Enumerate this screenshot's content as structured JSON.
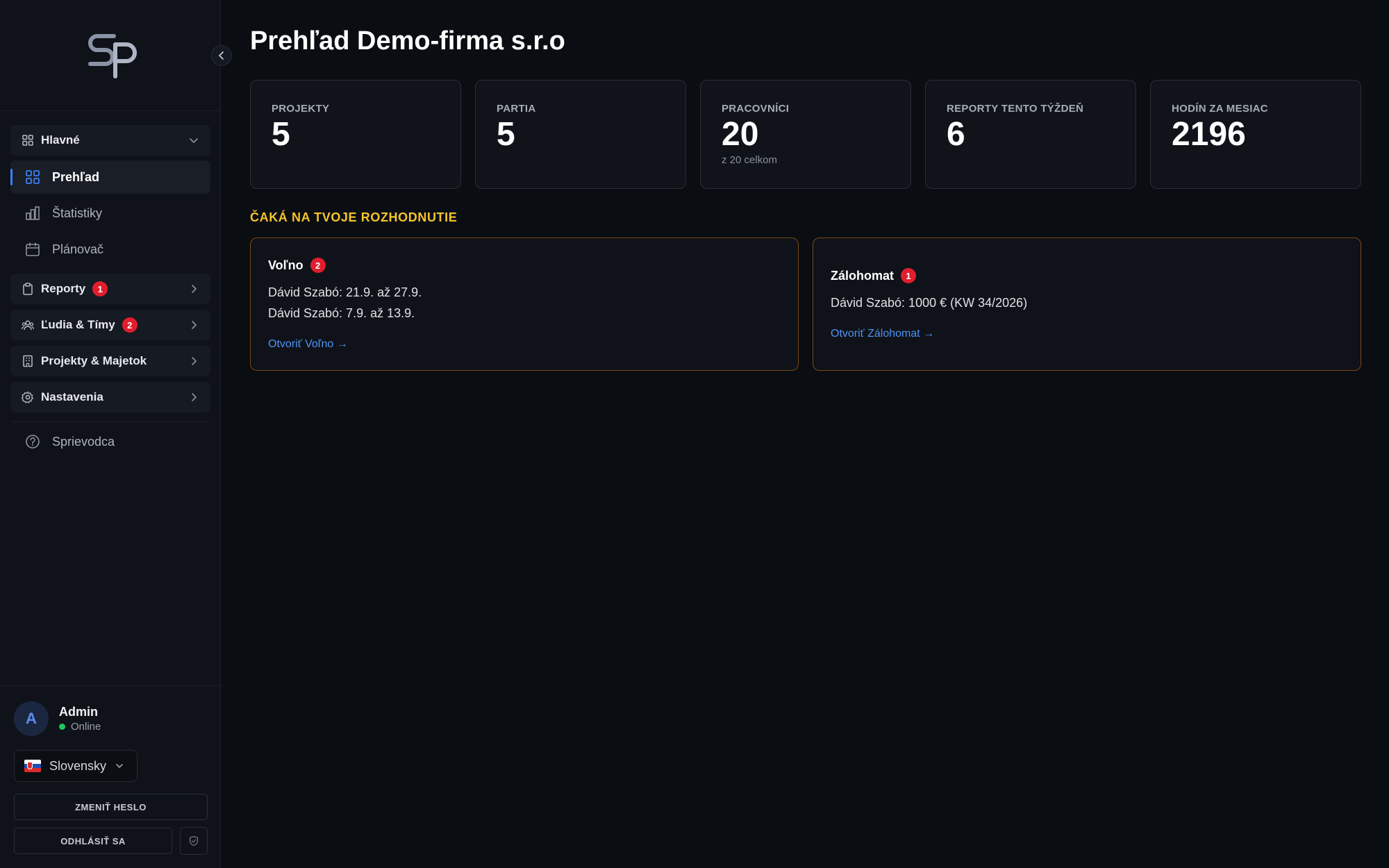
{
  "app": {
    "title": "Prehľad Demo-firma s.r.o"
  },
  "sidebar": {
    "groups": [
      {
        "label": "Hlavné"
      },
      {
        "label": "Reporty",
        "badge": "1"
      },
      {
        "label": "Ľudia & Tímy",
        "badge": "2"
      },
      {
        "label": "Projekty & Majetok"
      },
      {
        "label": "Nastavenia"
      }
    ],
    "items": [
      {
        "label": "Prehľad"
      },
      {
        "label": "Štatistiky"
      },
      {
        "label": "Plánovač"
      }
    ],
    "guide": "Sprievodca",
    "user": {
      "initial": "A",
      "name": "Admin",
      "status": "Online"
    },
    "language": "Slovensky",
    "change_password": "ZMENIŤ HESLO",
    "logout": "ODHLÁSIŤ SA"
  },
  "stats": [
    {
      "label": "PROJEKTY",
      "value": "5"
    },
    {
      "label": "PARTIA",
      "value": "5"
    },
    {
      "label": "PRACOVNÍCI",
      "value": "20",
      "sub": "z 20 celkom"
    },
    {
      "label": "REPORTY TENTO TÝŽDEŇ",
      "value": "6"
    },
    {
      "label": "HODÍN ZA MESIAC",
      "value": "2196"
    }
  ],
  "decisions": {
    "title": "ČAKÁ NA TVOJE ROZHODNUTIE",
    "cards": [
      {
        "title": "Voľno",
        "badge": "2",
        "lines": [
          "Dávid Szabó: 21.9. až 27.9.",
          "Dávid Szabó: 7.9. až 13.9."
        ],
        "link": "Otvoriť Voľno →"
      },
      {
        "title": "Zálohomat",
        "badge": "1",
        "lines": [
          "Dávid Szabó: 1000 € (KW 34/2026)"
        ],
        "link": "Otvoriť Zálohomat →"
      }
    ]
  },
  "colors": {
    "accent": "#3b82f6",
    "badge": "#e11d2e",
    "warning_title": "#f5c42c",
    "decision_border": "#7a4a14",
    "online": "#22c55e"
  }
}
